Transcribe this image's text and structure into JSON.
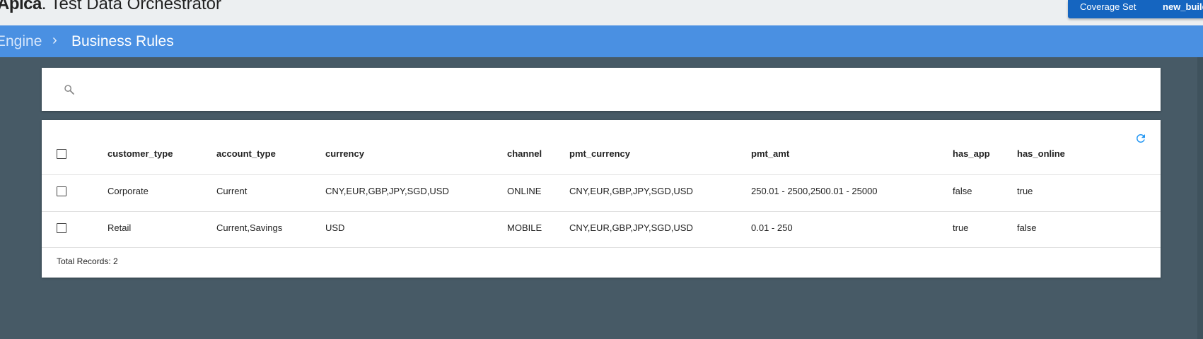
{
  "header": {
    "logo": "Apica",
    "logo_dot": ".",
    "app_title": "Test Data Orchestrator",
    "coverage_label": "Coverage Set",
    "coverage_value": "new_build"
  },
  "breadcrumb": {
    "previous": "Engine",
    "separator": "›",
    "current": "Business Rules"
  },
  "search": {
    "placeholder": "",
    "value": ""
  },
  "table": {
    "columns": [
      "customer_type",
      "account_type",
      "currency",
      "channel",
      "pmt_currency",
      "pmt_amt",
      "has_app",
      "has_online"
    ],
    "rows": [
      [
        "Corporate",
        "Current",
        "CNY,EUR,GBP,JPY,SGD,USD",
        "ONLINE",
        "CNY,EUR,GBP,JPY,SGD,USD",
        "250.01 - 2500,2500.01 - 25000",
        "false",
        "true"
      ],
      [
        "Retail",
        "Current,Savings",
        "USD",
        "MOBILE",
        "CNY,EUR,GBP,JPY,SGD,USD",
        "0.01 - 250",
        "true",
        "false"
      ]
    ],
    "total_records": "Total Records: 2"
  },
  "colors": {
    "topbar": "#eceff1",
    "crumbbar": "#4a90e2",
    "coverage": "#1565c0",
    "background": "#475a66",
    "refresh_icon": "#2196f3"
  },
  "icons": {
    "search": "search-icon",
    "refresh": "refresh-icon"
  }
}
